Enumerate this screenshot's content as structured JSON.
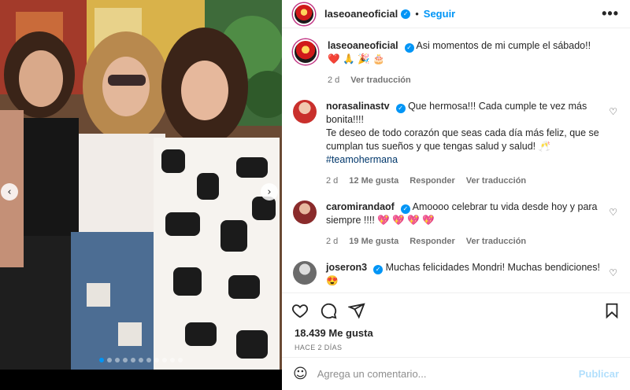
{
  "post": {
    "username": "laseoaneoficial",
    "follow_label": "Seguir",
    "separator": "•",
    "more_label": "•••",
    "caption_text": "Asi momentos de mi cumple el sábado!! ❤️ 🙏 🎉 🎂",
    "caption_time": "2 d",
    "caption_translate": "Ver traducción"
  },
  "comments": [
    {
      "username": "norasalinastv",
      "text_1": "Que hermosa!!! Cada cumple te vez más bonita!!!!",
      "text_2": "Te deseo de todo corazón que seas cada día más feliz, que se cumplan tus sueños y que tengas salud y salud! 🥂",
      "hashtag": "#teamohermana",
      "time": "2 d",
      "likes": "12 Me gusta",
      "reply": "Responder",
      "translate": "Ver traducción",
      "avatar_color": "#c9302c"
    },
    {
      "username": "caromirandaof",
      "text_1": "Amoooo celebrar tu vida desde hoy y para siempre !!!! 💖 💖 💖 💖",
      "time": "2 d",
      "likes": "19 Me gusta",
      "reply": "Responder",
      "translate": "Ver traducción",
      "avatar_color": "#8a2b2b"
    },
    {
      "username": "joseron3",
      "text_1": "Muchas felicidades Mondri! Muchas bendiciones! 😍",
      "avatar_color": "#6b6b6b"
    }
  ],
  "footer": {
    "likes": "18.439 Me gusta",
    "ago": "HACE 2 DÍAS",
    "comment_placeholder": "Agrega un comentario...",
    "publish_label": "Publicar",
    "emoji_icon": "☺"
  },
  "icons": {
    "verified": "✓",
    "heart_outline": "♡",
    "nav_left": "‹",
    "nav_right": "›"
  },
  "colors": {
    "accent": "#0095f6",
    "publish_disabled": "#b2dffc",
    "meta_gray": "#737373"
  },
  "carousel": {
    "count": 11,
    "active_index": 0
  }
}
